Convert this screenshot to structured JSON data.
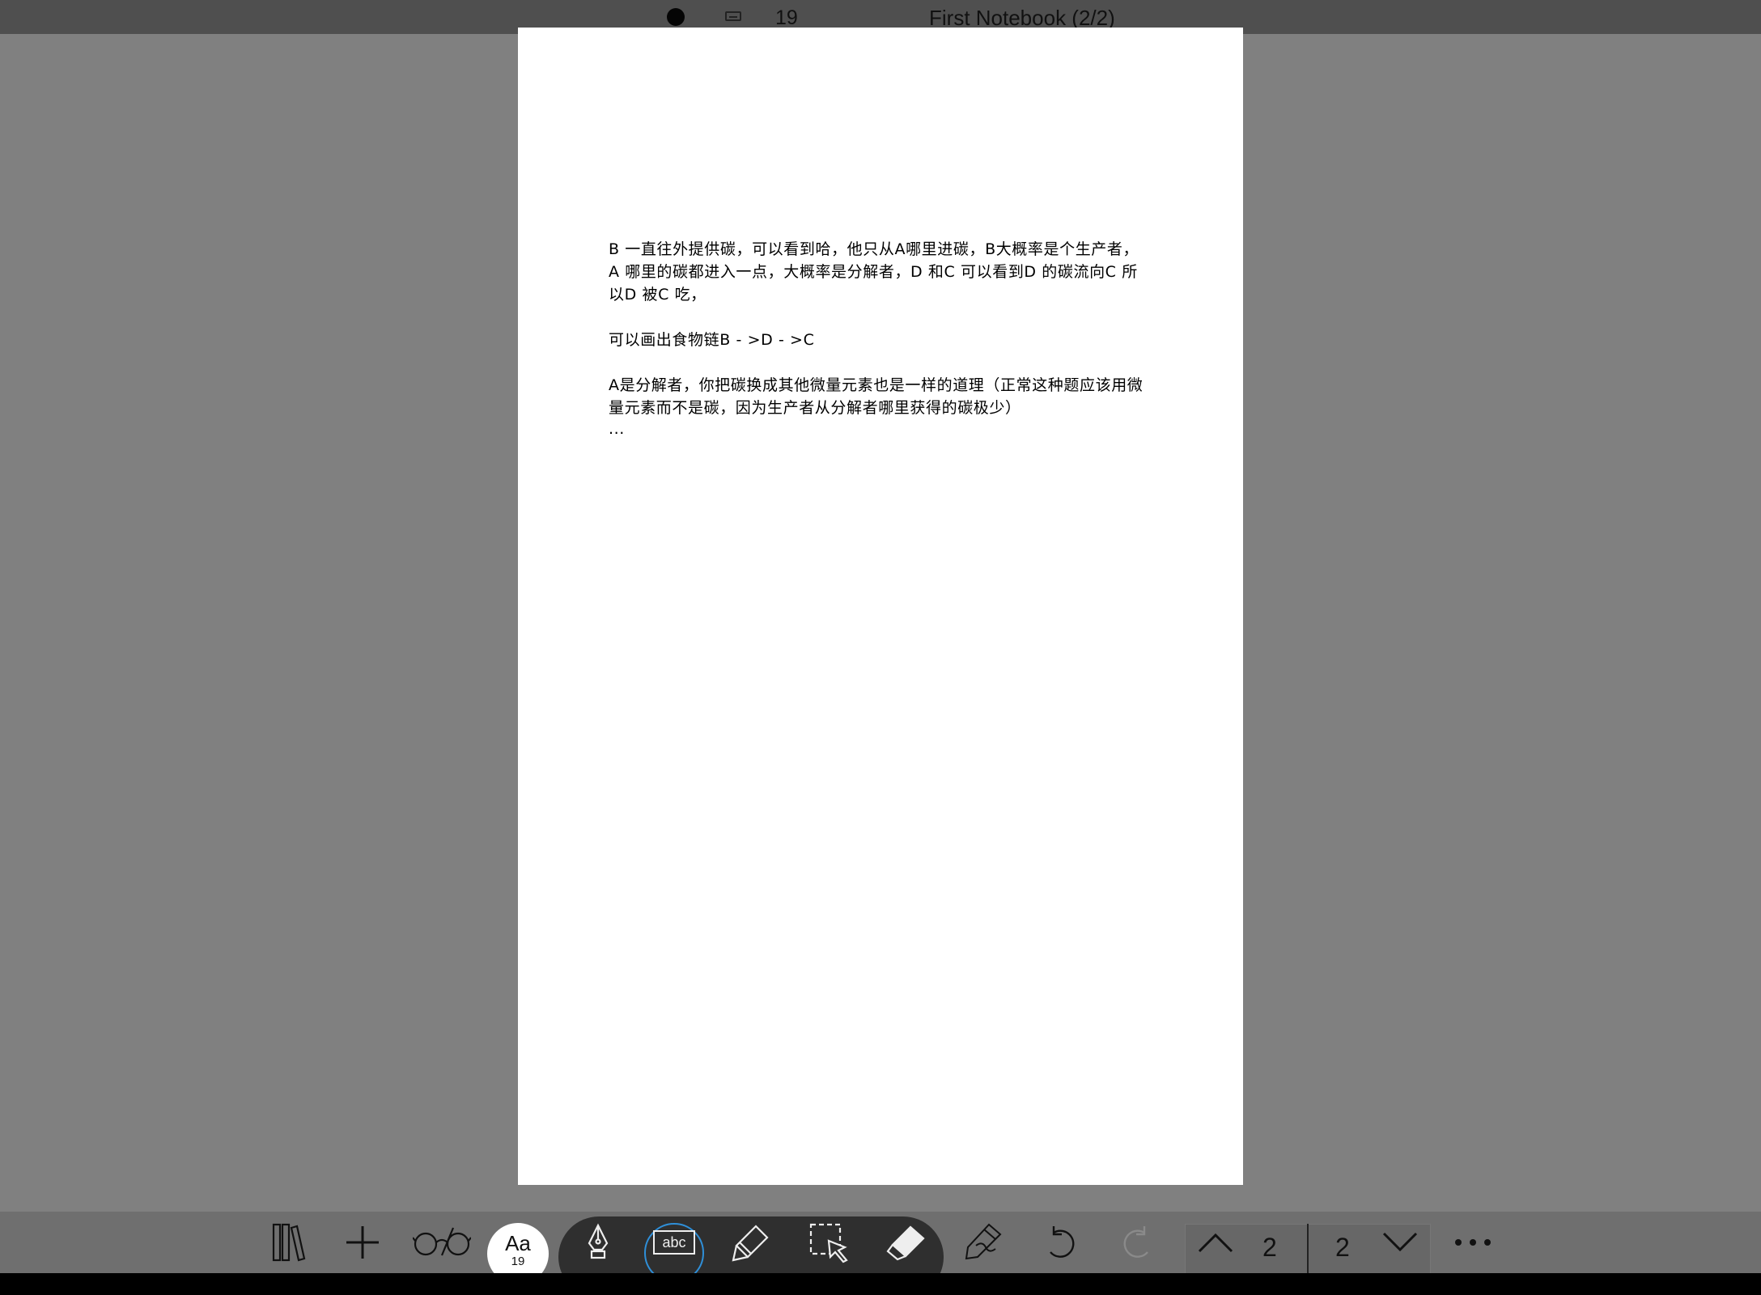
{
  "top_bar": {
    "status_icon": "filled-circle-icon",
    "keyboard_icon": "keyboard-icon",
    "count": "19",
    "title": "First Notebook (2/2)"
  },
  "page": {
    "paragraphs": [
      "B 一直往外提供碳，可以看到哈，他只从A哪里进碳，B大概率是个生产者，\nA 哪里的碳都进入一点，大概率是分解者，D 和C 可以看到D 的碳流向C 所\n以D 被C 吃，",
      "可以画出食物链B - >D - >C",
      "A是分解者，你把碳换成其他微量元素也是一样的道理（正常这种题应该用微\n量元素而不是碳，因为生产者从分解者哪里获得的碳极少）"
    ],
    "ellipsis": "..."
  },
  "toolbar": {
    "library_icon": "library-icon",
    "add_icon": "plus-icon",
    "reading_icon": "glasses-icon",
    "text_size_label": "Aa",
    "text_size_value": "19",
    "tools": [
      {
        "icon": "fountain-pen-icon"
      },
      {
        "icon": "text-box-icon",
        "label": "abc",
        "selected": true
      },
      {
        "icon": "highlighter-icon"
      },
      {
        "icon": "lasso-select-icon"
      },
      {
        "icon": "eraser-icon"
      }
    ],
    "pen-settings_icon": "pen-settings-icon",
    "undo_icon": "undo-icon",
    "redo_icon": "redo-icon",
    "page_up_icon": "chevron-up-icon",
    "current_page": "2",
    "total_pages": "2",
    "page_down_icon": "chevron-down-icon",
    "more_icon": "more-dots-icon"
  },
  "colors": {
    "background": "#808080",
    "top_bar": "#4f4f4f",
    "bottom_bar": "#6f6f6f",
    "pen_group": "#2f2f2f",
    "selection_ring": "#2f8fd8",
    "page": "#ffffff"
  }
}
